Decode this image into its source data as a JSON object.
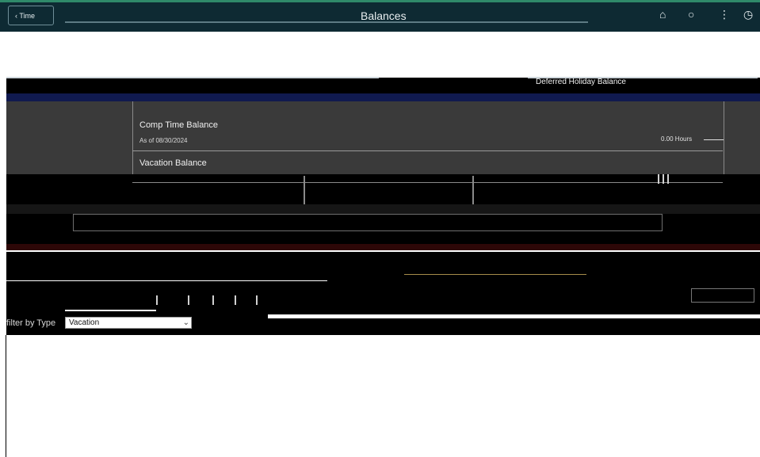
{
  "header": {
    "back_label": "Time",
    "title": "Balances",
    "icons": [
      "home-icon",
      "search-icon",
      "more-icon",
      "compass-icon"
    ]
  },
  "panels": {
    "right_title": "Deferred Holiday Balance",
    "balances": [
      {
        "name": "Comp Time Balance",
        "as_of": "As of 08/30/2024",
        "value": "0.00 Hours"
      },
      {
        "name": "Vacation Balance"
      }
    ]
  },
  "filter": {
    "label": "filter by Type",
    "selected": "Vacation"
  },
  "colors": {
    "header_bg": "#0e2a33",
    "accent": "#2f8a6a",
    "panel_bg": "#3a3a3a"
  }
}
